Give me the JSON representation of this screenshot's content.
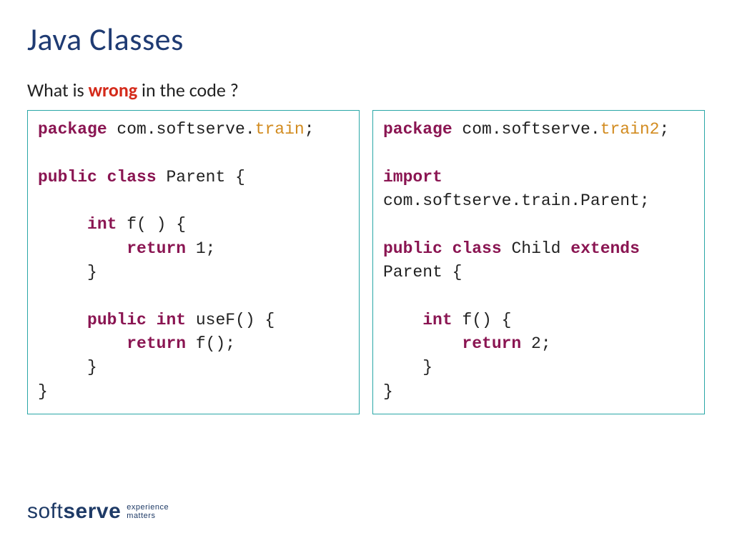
{
  "title": "Java Classes",
  "subtitle_before": "What is ",
  "subtitle_wrong": "wrong",
  "subtitle_after": " in the code ?",
  "left": {
    "l1a": "package",
    "l1b": " com.softserve.",
    "l1c": "train",
    "l1d": ";",
    "l2": "",
    "l3a": "public",
    "l3b": " ",
    "l3c": "class",
    "l3d": " Parent {",
    "l4": "",
    "l5a": "     ",
    "l5b": "int",
    "l5c": " f( ) {",
    "l6a": "         ",
    "l6b": "return",
    "l6c": " 1;",
    "l7": "     }",
    "l8": "",
    "l9a": "     ",
    "l9b": "public",
    "l9c": " ",
    "l9d": "int",
    "l9e": " useF() {",
    "l10a": "         ",
    "l10b": "return",
    "l10c": " f();",
    "l11": "     }",
    "l12": "}"
  },
  "right": {
    "l1a": "package",
    "l1b": " com.softserve.",
    "l1c": "train2",
    "l1d": ";",
    "l2": "",
    "l3a": "import",
    "l4": "com.softserve.train.Parent;",
    "l5": "",
    "l6a": "public",
    "l6b": " ",
    "l6c": "class",
    "l6d": " Child ",
    "l6e": "extends",
    "l7": "Parent {",
    "l8": "",
    "l9a": "    ",
    "l9b": "int",
    "l9c": " f() {",
    "l10a": "        ",
    "l10b": "return",
    "l10c": " 2;",
    "l11": "    }",
    "l12": "}"
  },
  "logo": {
    "soft": "soft",
    "serve": "serve",
    "tag1": "experience",
    "tag2": "matters"
  }
}
